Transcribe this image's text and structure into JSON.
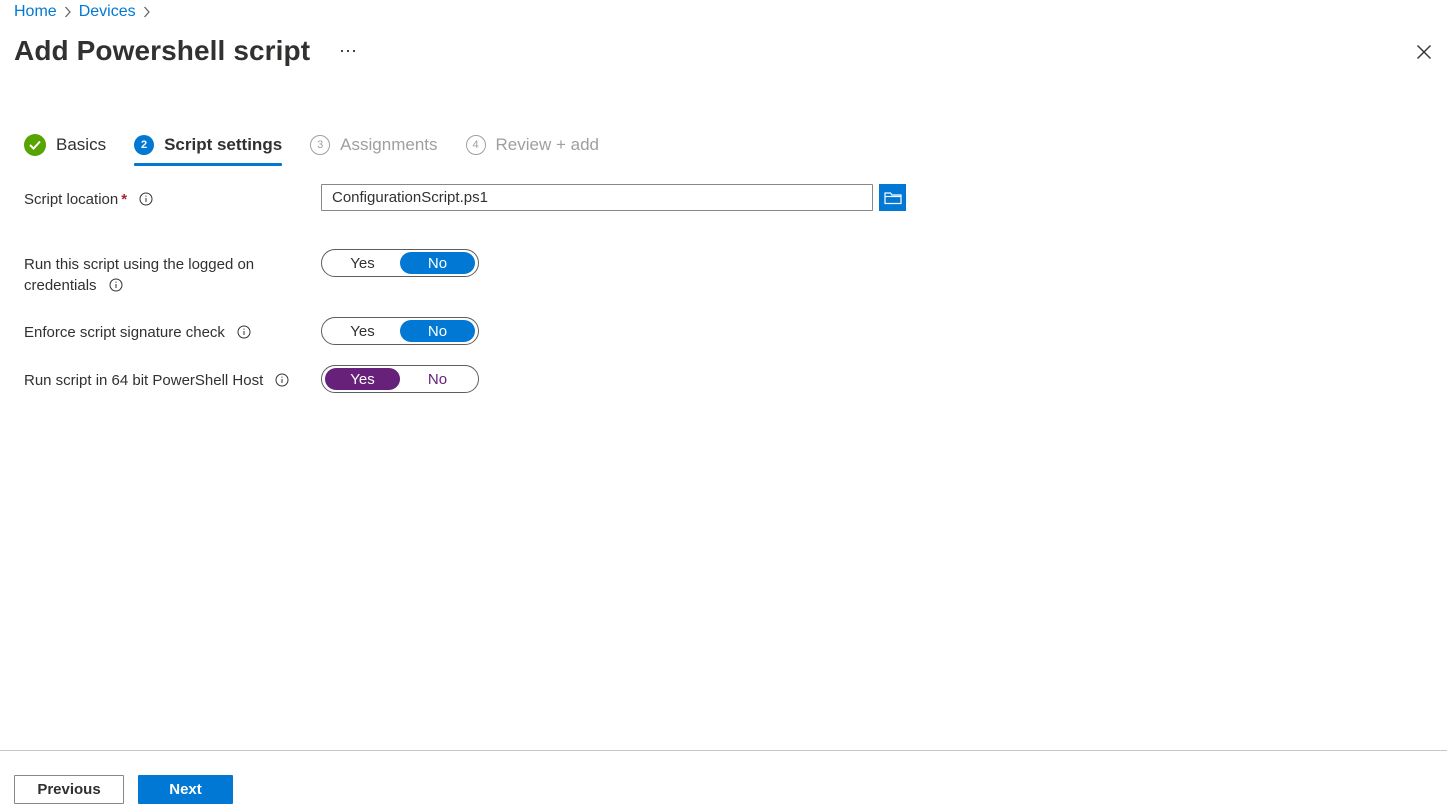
{
  "breadcrumb": {
    "items": [
      {
        "label": "Home"
      },
      {
        "label": "Devices"
      }
    ]
  },
  "header": {
    "title": "Add Powershell script",
    "more_icon": "ellipsis-icon",
    "close_icon": "close-icon"
  },
  "wizard": {
    "steps": [
      {
        "number": "",
        "label": "Basics",
        "state": "completed"
      },
      {
        "number": "2",
        "label": "Script settings",
        "state": "active"
      },
      {
        "number": "3",
        "label": "Assignments",
        "state": "pending"
      },
      {
        "number": "4",
        "label": "Review + add",
        "state": "pending"
      }
    ]
  },
  "form": {
    "script_location": {
      "label": "Script location",
      "required_mark": "*",
      "value": "ConfigurationScript.ps1",
      "browse_icon": "folder-icon"
    },
    "logged_on_credentials": {
      "label_line1": "Run this script using the logged on",
      "label_line2": "credentials",
      "options": [
        "Yes",
        "No"
      ],
      "selected": "No"
    },
    "signature_check": {
      "label": "Enforce script signature check",
      "options": [
        "Yes",
        "No"
      ],
      "selected": "No"
    },
    "run_64bit": {
      "label": "Run script in 64 bit PowerShell Host",
      "options": [
        "Yes",
        "No"
      ],
      "selected": "Yes"
    }
  },
  "footer": {
    "previous_label": "Previous",
    "next_label": "Next"
  },
  "colors": {
    "accent": "#0078d4",
    "success": "#57a300",
    "highlight": "#68217a",
    "required": "#a4262c"
  }
}
